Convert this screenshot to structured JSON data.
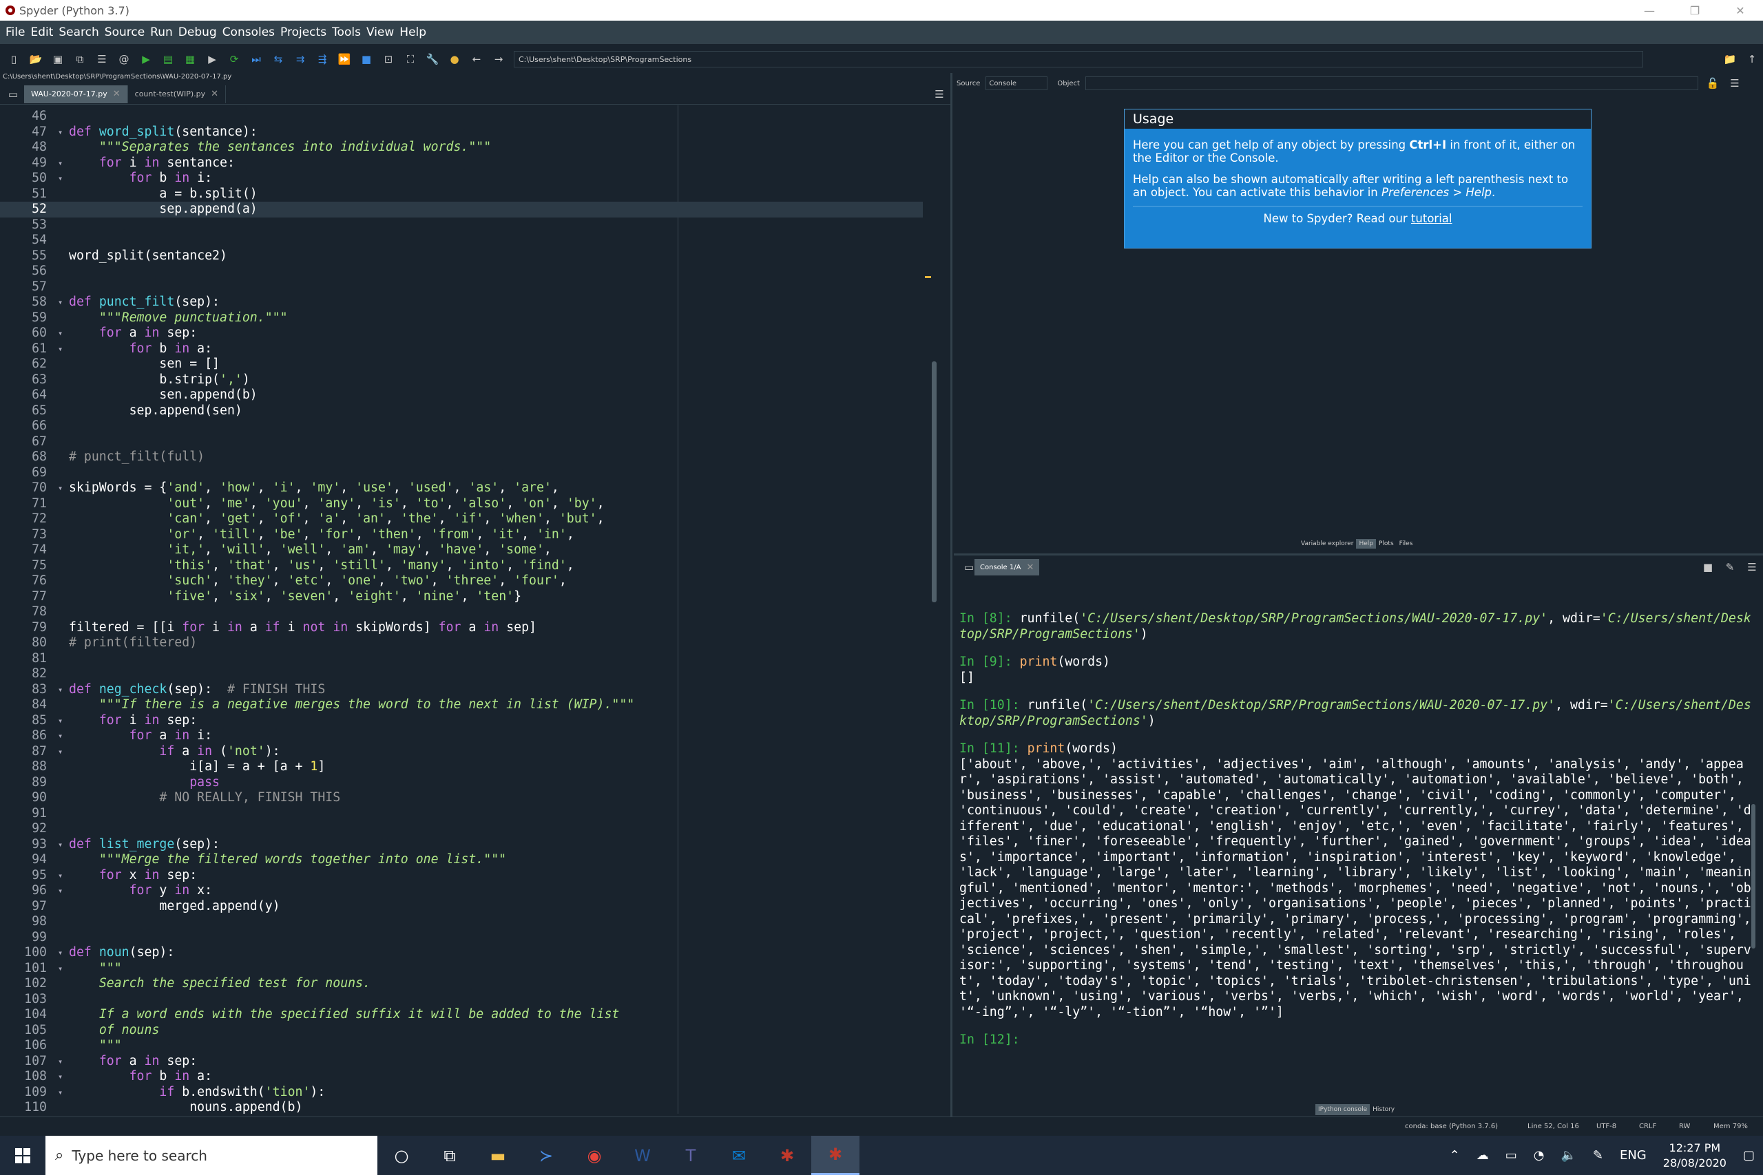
{
  "window": {
    "title": "Spyder (Python 3.7)",
    "minimize": "—",
    "restore": "❐",
    "close": "✕"
  },
  "menu": [
    "File",
    "Edit",
    "Search",
    "Source",
    "Run",
    "Debug",
    "Consoles",
    "Projects",
    "Tools",
    "View",
    "Help"
  ],
  "toolbar": {
    "path": "C:\\Users\\shent\\Desktop\\SRP\\ProgramSections"
  },
  "editor": {
    "file_path": "C:\\Users\\shent\\Desktop\\SRP\\ProgramSections\\WAU-2020-07-17.py",
    "tabs": [
      {
        "label": "WAU-2020-07-17.py",
        "active": true
      },
      {
        "label": "count-test(WIP).py",
        "active": false
      }
    ],
    "current_line": 52,
    "lines": [
      {
        "n": 46,
        "f": 0,
        "h": ""
      },
      {
        "n": 47,
        "f": 1,
        "h": "<span class=kw>def</span> <span class=fn>word_split</span>(sentance):"
      },
      {
        "n": 48,
        "f": 0,
        "h": "    <span class='st em'>\"\"\"Separates the sentances into individual words.\"\"\"</span>"
      },
      {
        "n": 49,
        "f": 1,
        "h": "    <span class=kw>for</span> i <span class=kw>in</span> sentance:"
      },
      {
        "n": 50,
        "f": 1,
        "h": "        <span class=kw>for</span> b <span class=kw>in</span> i:"
      },
      {
        "n": 51,
        "f": 0,
        "h": "            a = b.split()"
      },
      {
        "n": 52,
        "f": 0,
        "h": "            sep.append(a)"
      },
      {
        "n": 53,
        "f": 0,
        "h": ""
      },
      {
        "n": 54,
        "f": 0,
        "h": ""
      },
      {
        "n": 55,
        "f": 0,
        "h": "word_split(sentance2)"
      },
      {
        "n": 56,
        "f": 0,
        "h": ""
      },
      {
        "n": 57,
        "f": 0,
        "h": ""
      },
      {
        "n": 58,
        "f": 1,
        "h": "<span class=kw>def</span> <span class=fn>punct_filt</span>(sep):"
      },
      {
        "n": 59,
        "f": 0,
        "h": "    <span class='st em'>\"\"\"Remove punctuation.\"\"\"</span>"
      },
      {
        "n": 60,
        "f": 1,
        "h": "    <span class=kw>for</span> a <span class=kw>in</span> sep:"
      },
      {
        "n": 61,
        "f": 1,
        "h": "        <span class=kw>for</span> b <span class=kw>in</span> a:"
      },
      {
        "n": 62,
        "f": 0,
        "h": "            sen = []"
      },
      {
        "n": 63,
        "f": 0,
        "h": "            b.strip(<span class=st>','</span>)"
      },
      {
        "n": 64,
        "f": 0,
        "h": "            sen.append(b)"
      },
      {
        "n": 65,
        "f": 0,
        "h": "        sep.append(sen)"
      },
      {
        "n": 66,
        "f": 0,
        "h": ""
      },
      {
        "n": 67,
        "f": 0,
        "h": ""
      },
      {
        "n": 68,
        "f": 0,
        "h": "<span class=cm># punct_filt(full)</span>"
      },
      {
        "n": 69,
        "f": 0,
        "h": ""
      },
      {
        "n": 70,
        "f": 1,
        "h": "skipWords = {<span class=st>'and'</span>, <span class=st>'how'</span>, <span class=st>'i'</span>, <span class=st>'my'</span>, <span class=st>'use'</span>, <span class=st>'used'</span>, <span class=st>'as'</span>, <span class=st>'are'</span>,"
      },
      {
        "n": 71,
        "f": 0,
        "h": "             <span class=st>'out'</span>, <span class=st>'me'</span>, <span class=st>'you'</span>, <span class=st>'any'</span>, <span class=st>'is'</span>, <span class=st>'to'</span>, <span class=st>'also'</span>, <span class=st>'on'</span>, <span class=st>'by'</span>,"
      },
      {
        "n": 72,
        "f": 0,
        "h": "             <span class=st>'can'</span>, <span class=st>'get'</span>, <span class=st>'of'</span>, <span class=st>'a'</span>, <span class=st>'an'</span>, <span class=st>'the'</span>, <span class=st>'if'</span>, <span class=st>'when'</span>, <span class=st>'but'</span>,"
      },
      {
        "n": 73,
        "f": 0,
        "h": "             <span class=st>'or'</span>, <span class=st>'till'</span>, <span class=st>'be'</span>, <span class=st>'for'</span>, <span class=st>'then'</span>, <span class=st>'from'</span>, <span class=st>'it'</span>, <span class=st>'in'</span>,"
      },
      {
        "n": 74,
        "f": 0,
        "h": "             <span class=st>'it,'</span>, <span class=st>'will'</span>, <span class=st>'well'</span>, <span class=st>'am'</span>, <span class=st>'may'</span>, <span class=st>'have'</span>, <span class=st>'some'</span>,"
      },
      {
        "n": 75,
        "f": 0,
        "h": "             <span class=st>'this'</span>, <span class=st>'that'</span>, <span class=st>'us'</span>, <span class=st>'still'</span>, <span class=st>'many'</span>, <span class=st>'into'</span>, <span class=st>'find'</span>,"
      },
      {
        "n": 76,
        "f": 0,
        "h": "             <span class=st>'such'</span>, <span class=st>'they'</span>, <span class=st>'etc'</span>, <span class=st>'one'</span>, <span class=st>'two'</span>, <span class=st>'three'</span>, <span class=st>'four'</span>,"
      },
      {
        "n": 77,
        "f": 0,
        "h": "             <span class=st>'five'</span>, <span class=st>'six'</span>, <span class=st>'seven'</span>, <span class=st>'eight'</span>, <span class=st>'nine'</span>, <span class=st>'ten'</span>}"
      },
      {
        "n": 78,
        "f": 0,
        "h": ""
      },
      {
        "n": 79,
        "f": 0,
        "h": "filtered = [[i <span class=kw>for</span> i <span class=kw>in</span> a <span class=kw>if</span> i <span class=kw>not</span> <span class=kw>in</span> skipWords] <span class=kw>for</span> a <span class=kw>in</span> sep]"
      },
      {
        "n": 80,
        "f": 0,
        "h": "<span class=cm># print(filtered)</span>"
      },
      {
        "n": 81,
        "f": 0,
        "h": ""
      },
      {
        "n": 82,
        "f": 0,
        "h": ""
      },
      {
        "n": 83,
        "f": 1,
        "h": "<span class=kw>def</span> <span class=fn>neg_check</span>(sep):  <span class=cm># FINISH THIS</span>"
      },
      {
        "n": 84,
        "f": 0,
        "h": "    <span class='st em'>\"\"\"If there is a negative merges the word to the next in list (WIP).\"\"\"</span>"
      },
      {
        "n": 85,
        "f": 1,
        "h": "    <span class=kw>for</span> i <span class=kw>in</span> sep:"
      },
      {
        "n": 86,
        "f": 1,
        "h": "        <span class=kw>for</span> a <span class=kw>in</span> i:"
      },
      {
        "n": 87,
        "f": 1,
        "h": "            <span class=kw>if</span> a <span class=kw>in</span> (<span class=st>'not'</span>):"
      },
      {
        "n": 88,
        "f": 0,
        "h": "                i[a] = a + [a + <span class=nm>1</span>]"
      },
      {
        "n": 89,
        "f": 0,
        "h": "                <span class=kw>pass</span>"
      },
      {
        "n": 90,
        "f": 0,
        "h": "            <span class=cm># NO REALLY, FINISH THIS</span>"
      },
      {
        "n": 91,
        "f": 0,
        "h": ""
      },
      {
        "n": 92,
        "f": 0,
        "h": ""
      },
      {
        "n": 93,
        "f": 1,
        "h": "<span class=kw>def</span> <span class=fn>list_merge</span>(sep):"
      },
      {
        "n": 94,
        "f": 0,
        "h": "    <span class='st em'>\"\"\"Merge the filtered words together into one list.\"\"\"</span>"
      },
      {
        "n": 95,
        "f": 1,
        "h": "    <span class=kw>for</span> x <span class=kw>in</span> sep:"
      },
      {
        "n": 96,
        "f": 1,
        "h": "        <span class=kw>for</span> y <span class=kw>in</span> x:"
      },
      {
        "n": 97,
        "f": 0,
        "h": "            merged.append(y)"
      },
      {
        "n": 98,
        "f": 0,
        "h": ""
      },
      {
        "n": 99,
        "f": 0,
        "h": ""
      },
      {
        "n": 100,
        "f": 1,
        "h": "<span class=kw>def</span> <span class=fn>noun</span>(sep):"
      },
      {
        "n": 101,
        "f": 1,
        "h": "    <span class='st em'>\"\"\"</span>"
      },
      {
        "n": 102,
        "f": 0,
        "h": "    <span class='st em'>Search the specified test for nouns.</span>"
      },
      {
        "n": 103,
        "f": 0,
        "h": ""
      },
      {
        "n": 104,
        "f": 0,
        "h": "    <span class='st em'>If a word ends with the specified suffix it will be added to the list</span>"
      },
      {
        "n": 105,
        "f": 0,
        "h": "    <span class='st em'>of nouns</span>"
      },
      {
        "n": 106,
        "f": 0,
        "h": "    <span class='st em'>\"\"\"</span>"
      },
      {
        "n": 107,
        "f": 1,
        "h": "    <span class=kw>for</span> a <span class=kw>in</span> sep:"
      },
      {
        "n": 108,
        "f": 1,
        "h": "        <span class=kw>for</span> b <span class=kw>in</span> a:"
      },
      {
        "n": 109,
        "f": 1,
        "h": "            <span class=kw>if</span> b.endswith(<span class=st>'tion'</span>):"
      },
      {
        "n": 110,
        "f": 0,
        "h": "                nouns.append(b)"
      }
    ]
  },
  "help": {
    "source_label": "Source",
    "source_value": "Console",
    "object_label": "Object",
    "usage_title": "Usage",
    "p1_a": "Here you can get help of any object by pressing ",
    "p1_b": "Ctrl+I",
    "p1_c": " in front of it, either on the Editor or the Console.",
    "p2_a": "Help can also be shown automatically after writing a left parenthesis next to an object. You can activate this behavior in ",
    "p2_b": "Preferences > Help",
    "p2_c": ".",
    "new_a": "New to Spyder? Read our ",
    "new_link": "tutorial",
    "tabs": [
      "Variable explorer",
      "Help",
      "Plots",
      "Files"
    ]
  },
  "console": {
    "tab": "Console 1/A",
    "blocks": [
      {
        "prompt": "In [8]: ",
        "h": "runfile(<span class=stl>'C:/Users/shent/Desktop/SRP/ProgramSections/WAU-2020-07-17.py'</span>, wdir=<span class=stl>'C:/Users/shent/Desktop/SRP/ProgramSections'</span>)"
      },
      {
        "prompt": "In [9]: ",
        "h": "<span class=or>print</span>(words)\n[]"
      },
      {
        "prompt": "In [10]: ",
        "h": "runfile(<span class=stl>'C:/Users/shent/Desktop/SRP/ProgramSections/WAU-2020-07-17.py'</span>, wdir=<span class=stl>'C:/Users/shent/Desktop/SRP/ProgramSections'</span>)"
      },
      {
        "prompt": "In [11]: ",
        "h": "<span class=or>print</span>(words)\n['about', 'above,', 'activities', 'adjectives', 'aim', 'although', 'amounts', 'analysis', 'andy', 'appear', 'aspirations', 'assist', 'automated', 'automatically', 'automation', 'available', 'believe', 'both', 'business', 'businesses', 'capable', 'challenges', 'change', 'civil', 'coding', 'commonly', 'computer', 'continuous', 'could', 'create', 'creation', 'currently', 'currently,', 'currey', 'data', 'determine', 'different', 'due', 'educational', 'english', 'enjoy', 'etc,', 'even', 'facilitate', 'fairly', 'features', 'files', 'finer', 'foreseeable', 'frequently', 'further', 'gained', 'government', 'groups', 'idea', 'ideas', 'importance', 'important', 'information', 'inspiration', 'interest', 'key', 'keyword', 'knowledge', 'lack', 'language', 'large', 'later', 'learning', 'library', 'likely', 'list', 'looking', 'main', 'meaningful', 'mentioned', 'mentor', 'mentor:', 'methods', 'morphemes', 'need', 'negative', 'not', 'nouns,', 'objectives', 'occurring', 'ones', 'only', 'organisations', 'people', 'pieces', 'planned', 'points', 'practical', 'prefixes,', 'present', 'primarily', 'primary', 'process,', 'processing', 'program', 'programming', 'project', 'project,', 'question', 'recently', 'related', 'relevant', 'researching', 'rising', 'roles', 'science', 'sciences', 'shen', 'simple,', 'smallest', 'sorting', 'srp', 'strictly', 'successful', 'supervisor:', 'supporting', 'systems', 'tend', 'testing', 'text', 'themselves', 'this,', 'through', 'throughout', 'today', 'today's', 'topic', 'topics', 'trials', 'tribolet-christensen', 'tribulations', 'type', 'unit', 'unknown', 'using', 'various', 'verbs', 'verbs,', 'which', 'wish', 'word', 'words', 'world', 'year', '“-ing”,', '“-ly”', '“-tion”', '“how', '”']"
      },
      {
        "prompt": "In [12]: ",
        "h": ""
      }
    ],
    "tabs": [
      "IPython console",
      "History"
    ]
  },
  "status": {
    "conda": "conda: base (Python 3.7.6)",
    "position": "Line 52, Col 16",
    "encoding": "UTF-8",
    "eol": "CRLF",
    "rw": "RW",
    "mem": "Mem 79%"
  },
  "taskbar": {
    "search_placeholder": "Type here to search",
    "lang": "ENG",
    "time": "12:27 PM",
    "date": "28/08/2020"
  }
}
